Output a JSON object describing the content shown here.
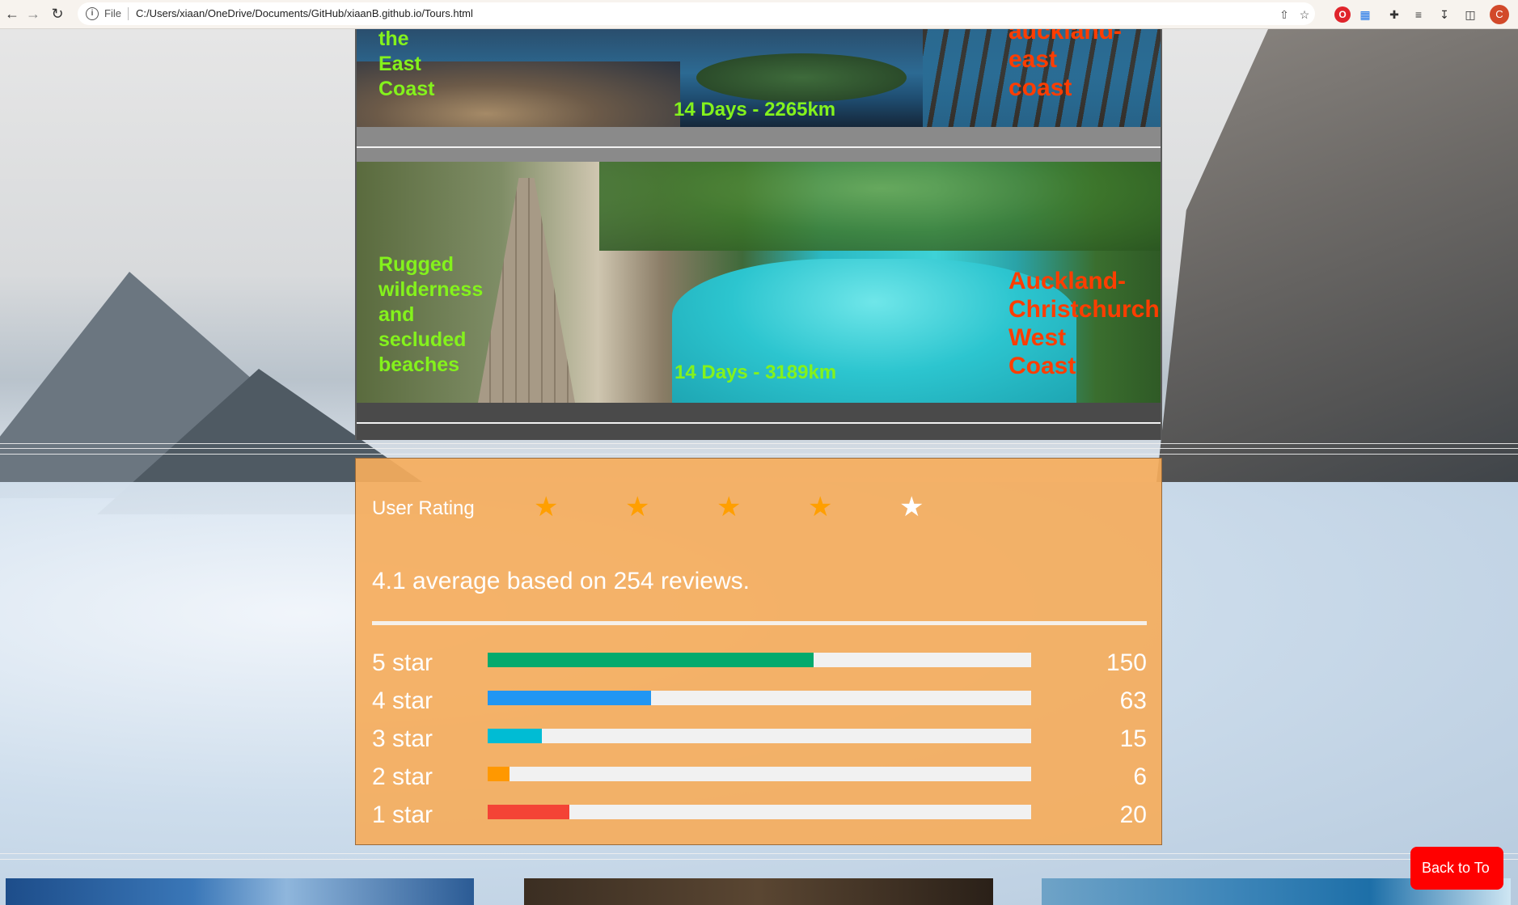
{
  "browser": {
    "file_label": "File",
    "url": "C:/Users/xiaan/OneDrive/Documents/GitHub/xiaanB.github.io/Tours.html",
    "profile_initial": "C"
  },
  "tours": [
    {
      "description_lines": [
        "the",
        "East",
        "Coast"
      ],
      "duration": "14 Days - 2265km",
      "route_lines": [
        "auckland-",
        "east",
        "coast"
      ]
    },
    {
      "description_lines": [
        "Rugged",
        "wilderness",
        "and",
        "secluded",
        "beaches"
      ],
      "duration": "14 Days - 3189km",
      "route_lines": [
        "Auckland-",
        "Christchurch-",
        "West",
        "Coast"
      ]
    }
  ],
  "rating": {
    "title": "User Rating",
    "stars": [
      {
        "icon": "star-icon",
        "filled": true
      },
      {
        "icon": "star-icon",
        "filled": true
      },
      {
        "icon": "star-icon",
        "filled": true
      },
      {
        "icon": "star-icon",
        "filled": true
      },
      {
        "icon": "star-icon",
        "filled": false
      }
    ],
    "average_text": "4.1 average based on 254 reviews.",
    "rows": [
      {
        "label": "5 star",
        "count": "150",
        "fill_percent": 60,
        "color": "#04AA6D"
      },
      {
        "label": "4 star",
        "count": "63",
        "fill_percent": 30,
        "color": "#2196F3"
      },
      {
        "label": "3 star",
        "count": "15",
        "fill_percent": 10,
        "color": "#00bcd4"
      },
      {
        "label": "2 star",
        "count": "6",
        "fill_percent": 4,
        "color": "#ff9800"
      },
      {
        "label": "1 star",
        "count": "20",
        "fill_percent": 15,
        "color": "#f44336"
      }
    ]
  },
  "back_to_top_label": "Back to To",
  "colors": {
    "tour_text_green": "#84f21c",
    "tour_text_red": "#ff3d00",
    "star_filled": "#ff9f00",
    "star_empty": "#ffffff",
    "back_to_top_bg": "#ff0000"
  }
}
